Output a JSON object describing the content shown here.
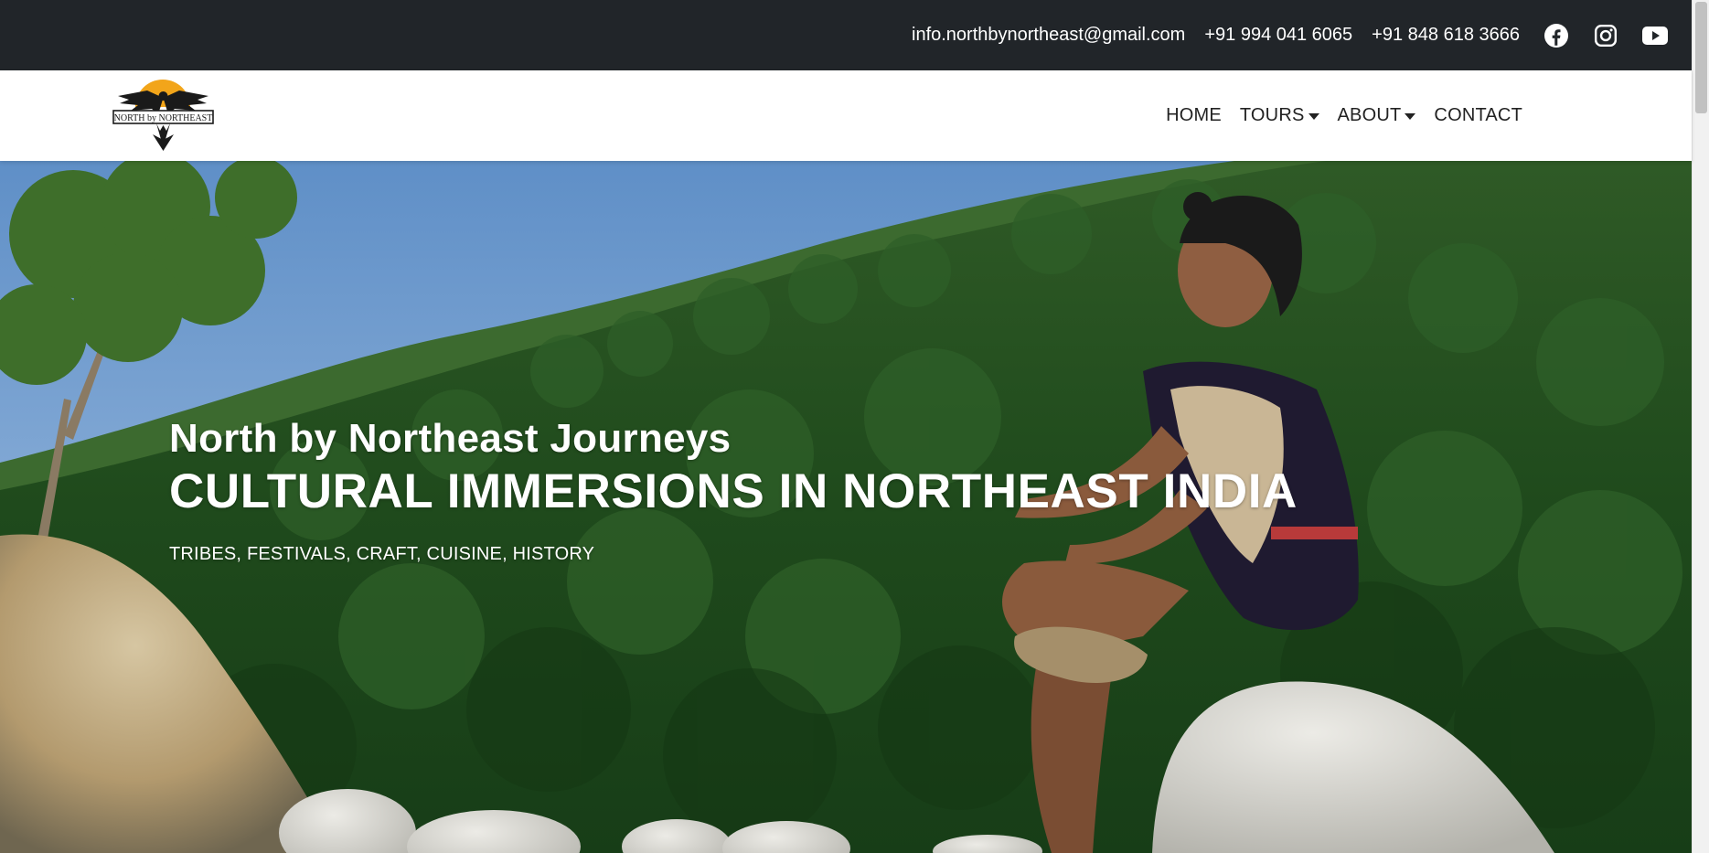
{
  "topbar": {
    "email": "info.northbynortheast@gmail.com",
    "phone1": "+91 994 041 6065",
    "phone2": "+91 848 618 3666",
    "social_icons": [
      "facebook-icon",
      "instagram-icon",
      "youtube-icon"
    ]
  },
  "navbar": {
    "logo_text": "NORTH by NORTHEAST",
    "items": [
      {
        "label": "HOME",
        "dropdown": false
      },
      {
        "label": "TOURS",
        "dropdown": true
      },
      {
        "label": "ABOUT",
        "dropdown": true
      },
      {
        "label": "CONTACT",
        "dropdown": false
      }
    ]
  },
  "hero": {
    "title": "North by Northeast Journeys",
    "headline": "CULTURAL IMMERSIONS IN NORTHEAST INDIA",
    "tagline": "TRIBES, FESTIVALS, CRAFT, CUISINE, HISTORY"
  },
  "colors": {
    "topbar_bg": "#212529",
    "text_light": "#ffffff",
    "nav_text": "#222222",
    "logo_sun": "#f2a51a"
  }
}
